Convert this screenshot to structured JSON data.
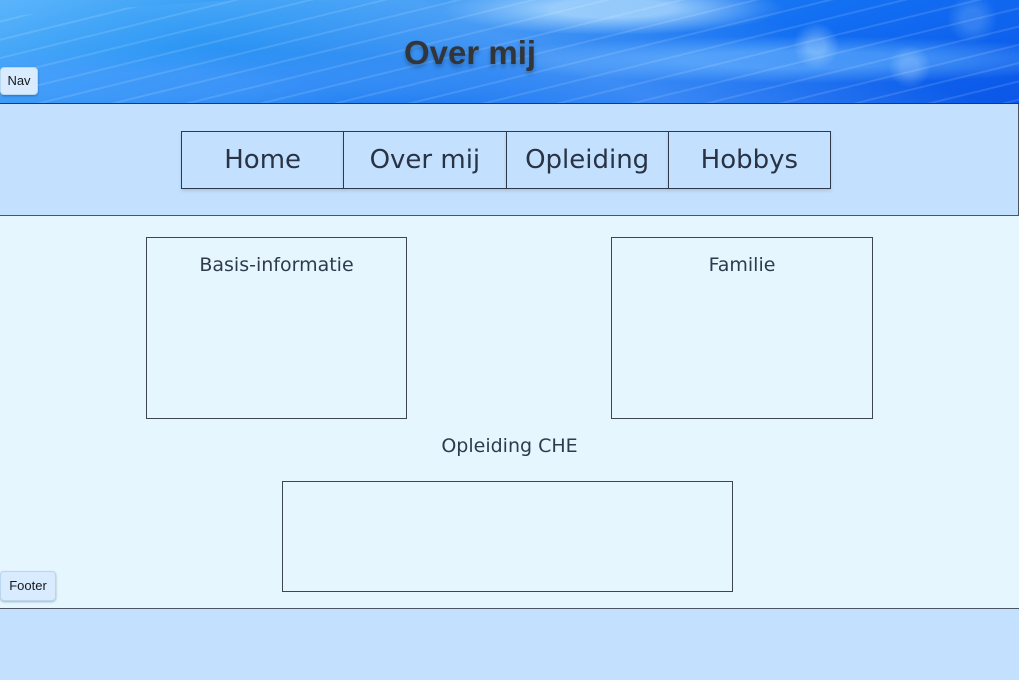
{
  "header": {
    "title": "Over mij"
  },
  "frame_labels": {
    "nav": "Nav",
    "footer": "Footer"
  },
  "navigation": {
    "items": [
      {
        "label": "Home"
      },
      {
        "label": "Over mij"
      },
      {
        "label": "Opleiding"
      },
      {
        "label": "Hobbys"
      }
    ]
  },
  "content": {
    "basis_title": "Basis-informatie",
    "familie_title": "Familie",
    "education_title": "Opleiding CHE"
  },
  "colors": {
    "header_blue": "#1f7ef1",
    "nav_background": "#c3e1ff",
    "content_background": "#e6f6ff",
    "border": "#3e4552"
  }
}
